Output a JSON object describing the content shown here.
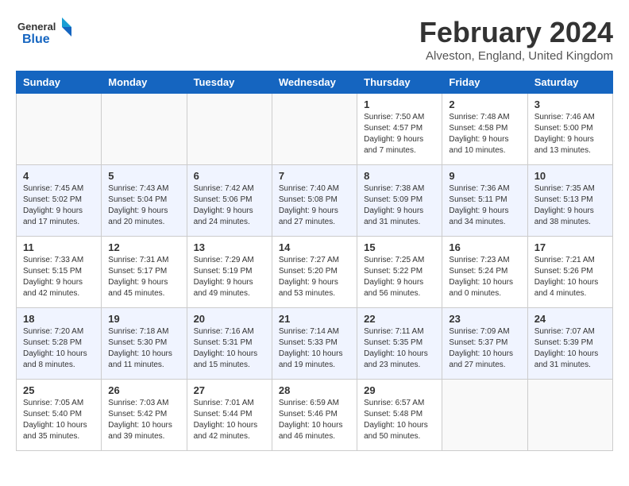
{
  "header": {
    "logo_line1": "General",
    "logo_line2": "Blue",
    "month": "February 2024",
    "location": "Alveston, England, United Kingdom"
  },
  "weekdays": [
    "Sunday",
    "Monday",
    "Tuesday",
    "Wednesday",
    "Thursday",
    "Friday",
    "Saturday"
  ],
  "weeks": [
    [
      {
        "num": "",
        "info": ""
      },
      {
        "num": "",
        "info": ""
      },
      {
        "num": "",
        "info": ""
      },
      {
        "num": "",
        "info": ""
      },
      {
        "num": "1",
        "info": "Sunrise: 7:50 AM\nSunset: 4:57 PM\nDaylight: 9 hours\nand 7 minutes."
      },
      {
        "num": "2",
        "info": "Sunrise: 7:48 AM\nSunset: 4:58 PM\nDaylight: 9 hours\nand 10 minutes."
      },
      {
        "num": "3",
        "info": "Sunrise: 7:46 AM\nSunset: 5:00 PM\nDaylight: 9 hours\nand 13 minutes."
      }
    ],
    [
      {
        "num": "4",
        "info": "Sunrise: 7:45 AM\nSunset: 5:02 PM\nDaylight: 9 hours\nand 17 minutes."
      },
      {
        "num": "5",
        "info": "Sunrise: 7:43 AM\nSunset: 5:04 PM\nDaylight: 9 hours\nand 20 minutes."
      },
      {
        "num": "6",
        "info": "Sunrise: 7:42 AM\nSunset: 5:06 PM\nDaylight: 9 hours\nand 24 minutes."
      },
      {
        "num": "7",
        "info": "Sunrise: 7:40 AM\nSunset: 5:08 PM\nDaylight: 9 hours\nand 27 minutes."
      },
      {
        "num": "8",
        "info": "Sunrise: 7:38 AM\nSunset: 5:09 PM\nDaylight: 9 hours\nand 31 minutes."
      },
      {
        "num": "9",
        "info": "Sunrise: 7:36 AM\nSunset: 5:11 PM\nDaylight: 9 hours\nand 34 minutes."
      },
      {
        "num": "10",
        "info": "Sunrise: 7:35 AM\nSunset: 5:13 PM\nDaylight: 9 hours\nand 38 minutes."
      }
    ],
    [
      {
        "num": "11",
        "info": "Sunrise: 7:33 AM\nSunset: 5:15 PM\nDaylight: 9 hours\nand 42 minutes."
      },
      {
        "num": "12",
        "info": "Sunrise: 7:31 AM\nSunset: 5:17 PM\nDaylight: 9 hours\nand 45 minutes."
      },
      {
        "num": "13",
        "info": "Sunrise: 7:29 AM\nSunset: 5:19 PM\nDaylight: 9 hours\nand 49 minutes."
      },
      {
        "num": "14",
        "info": "Sunrise: 7:27 AM\nSunset: 5:20 PM\nDaylight: 9 hours\nand 53 minutes."
      },
      {
        "num": "15",
        "info": "Sunrise: 7:25 AM\nSunset: 5:22 PM\nDaylight: 9 hours\nand 56 minutes."
      },
      {
        "num": "16",
        "info": "Sunrise: 7:23 AM\nSunset: 5:24 PM\nDaylight: 10 hours\nand 0 minutes."
      },
      {
        "num": "17",
        "info": "Sunrise: 7:21 AM\nSunset: 5:26 PM\nDaylight: 10 hours\nand 4 minutes."
      }
    ],
    [
      {
        "num": "18",
        "info": "Sunrise: 7:20 AM\nSunset: 5:28 PM\nDaylight: 10 hours\nand 8 minutes."
      },
      {
        "num": "19",
        "info": "Sunrise: 7:18 AM\nSunset: 5:30 PM\nDaylight: 10 hours\nand 11 minutes."
      },
      {
        "num": "20",
        "info": "Sunrise: 7:16 AM\nSunset: 5:31 PM\nDaylight: 10 hours\nand 15 minutes."
      },
      {
        "num": "21",
        "info": "Sunrise: 7:14 AM\nSunset: 5:33 PM\nDaylight: 10 hours\nand 19 minutes."
      },
      {
        "num": "22",
        "info": "Sunrise: 7:11 AM\nSunset: 5:35 PM\nDaylight: 10 hours\nand 23 minutes."
      },
      {
        "num": "23",
        "info": "Sunrise: 7:09 AM\nSunset: 5:37 PM\nDaylight: 10 hours\nand 27 minutes."
      },
      {
        "num": "24",
        "info": "Sunrise: 7:07 AM\nSunset: 5:39 PM\nDaylight: 10 hours\nand 31 minutes."
      }
    ],
    [
      {
        "num": "25",
        "info": "Sunrise: 7:05 AM\nSunset: 5:40 PM\nDaylight: 10 hours\nand 35 minutes."
      },
      {
        "num": "26",
        "info": "Sunrise: 7:03 AM\nSunset: 5:42 PM\nDaylight: 10 hours\nand 39 minutes."
      },
      {
        "num": "27",
        "info": "Sunrise: 7:01 AM\nSunset: 5:44 PM\nDaylight: 10 hours\nand 42 minutes."
      },
      {
        "num": "28",
        "info": "Sunrise: 6:59 AM\nSunset: 5:46 PM\nDaylight: 10 hours\nand 46 minutes."
      },
      {
        "num": "29",
        "info": "Sunrise: 6:57 AM\nSunset: 5:48 PM\nDaylight: 10 hours\nand 50 minutes."
      },
      {
        "num": "",
        "info": ""
      },
      {
        "num": "",
        "info": ""
      }
    ]
  ]
}
